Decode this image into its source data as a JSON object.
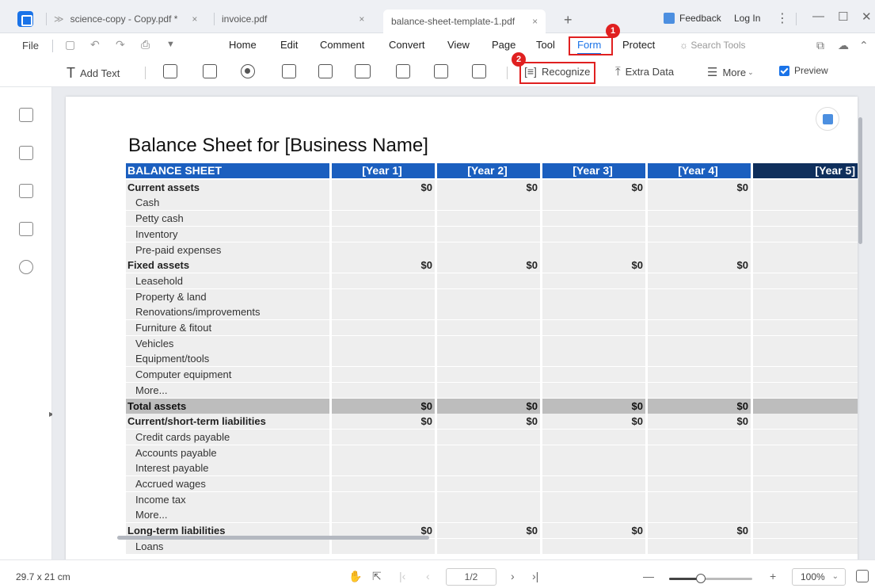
{
  "tabs": [
    {
      "label": "science-copy - Copy.pdf *",
      "close": "×"
    },
    {
      "label": "invoice.pdf",
      "close": "×"
    },
    {
      "label": "balance-sheet-template-1.pdf",
      "close": "×"
    }
  ],
  "titlebar": {
    "new_tab": "+",
    "feedback": "Feedback",
    "login": "Log In",
    "more": "⋮",
    "minimize": "—",
    "maximize": "☐",
    "close": "✕"
  },
  "menu": {
    "file": "File",
    "items": [
      "Home",
      "Edit",
      "Comment",
      "Convert",
      "View",
      "Page",
      "Tool",
      "Form",
      "Protect"
    ],
    "active": "Form",
    "search_placeholder": "Search Tools"
  },
  "toolbar": {
    "add_text": "Add Text",
    "recognize": "Recognize",
    "extra_data": "Extra Data",
    "more": "More",
    "preview": "Preview"
  },
  "annotations": {
    "badge1": "1",
    "badge2": "2"
  },
  "document": {
    "title": "Balance Sheet for [Business Name]",
    "headers": [
      "BALANCE SHEET",
      "[Year 1]",
      "[Year 2]",
      "[Year 3]",
      "[Year 4]",
      "[Year 5]"
    ],
    "rows": [
      {
        "type": "group",
        "cells": [
          "Current assets",
          "$0",
          "$0",
          "$0",
          "$0",
          ""
        ]
      },
      {
        "type": "item",
        "cells": [
          "Cash",
          "",
          "",
          "",
          "",
          ""
        ]
      },
      {
        "type": "item",
        "cells": [
          "Petty cash",
          "",
          "",
          "",
          "",
          ""
        ]
      },
      {
        "type": "item",
        "cells": [
          "Inventory",
          "",
          "",
          "",
          "",
          ""
        ]
      },
      {
        "type": "item",
        "cells": [
          "Pre-paid expenses",
          "",
          "",
          "",
          "",
          ""
        ]
      },
      {
        "type": "group",
        "cells": [
          "Fixed assets",
          "$0",
          "$0",
          "$0",
          "$0",
          ""
        ]
      },
      {
        "type": "item",
        "cells": [
          "Leasehold",
          "",
          "",
          "",
          "",
          ""
        ]
      },
      {
        "type": "item",
        "cells": [
          "Property & land",
          "",
          "",
          "",
          "",
          ""
        ]
      },
      {
        "type": "item",
        "cells": [
          "Renovations/improvements",
          "",
          "",
          "",
          "",
          ""
        ]
      },
      {
        "type": "item",
        "cells": [
          "Furniture & fitout",
          "",
          "",
          "",
          "",
          ""
        ]
      },
      {
        "type": "item",
        "cells": [
          "Vehicles",
          "",
          "",
          "",
          "",
          ""
        ]
      },
      {
        "type": "item",
        "cells": [
          "Equipment/tools",
          "",
          "",
          "",
          "",
          ""
        ]
      },
      {
        "type": "item",
        "cells": [
          "Computer equipment",
          "",
          "",
          "",
          "",
          ""
        ]
      },
      {
        "type": "item",
        "cells": [
          "More...",
          "",
          "",
          "",
          "",
          ""
        ]
      },
      {
        "type": "total",
        "cells": [
          "Total assets",
          "$0",
          "$0",
          "$0",
          "$0",
          ""
        ]
      },
      {
        "type": "group",
        "cells": [
          "Current/short-term liabilities",
          "$0",
          "$0",
          "$0",
          "$0",
          ""
        ]
      },
      {
        "type": "item",
        "cells": [
          "Credit cards payable",
          "",
          "",
          "",
          "",
          ""
        ]
      },
      {
        "type": "item",
        "cells": [
          "Accounts payable",
          "",
          "",
          "",
          "",
          ""
        ]
      },
      {
        "type": "item",
        "cells": [
          "Interest payable",
          "",
          "",
          "",
          "",
          ""
        ]
      },
      {
        "type": "item",
        "cells": [
          "Accrued wages",
          "",
          "",
          "",
          "",
          ""
        ]
      },
      {
        "type": "item",
        "cells": [
          "Income tax",
          "",
          "",
          "",
          "",
          ""
        ]
      },
      {
        "type": "item",
        "cells": [
          "More...",
          "",
          "",
          "",
          "",
          ""
        ]
      },
      {
        "type": "group",
        "cells": [
          "Long-term liabilities",
          "$0",
          "$0",
          "$0",
          "$0",
          ""
        ]
      },
      {
        "type": "item",
        "cells": [
          "Loans",
          "",
          "",
          "",
          "",
          ""
        ]
      }
    ]
  },
  "status": {
    "page_size": "29.7 x 21 cm",
    "page_indicator": "1/2",
    "zoom": "100%",
    "zoom_level": 0.38
  },
  "colors": {
    "accent": "#1a73e8",
    "header_blue": "#1b5fbf",
    "header_dark": "#0f2f5c",
    "highlight_red": "#e02020"
  }
}
